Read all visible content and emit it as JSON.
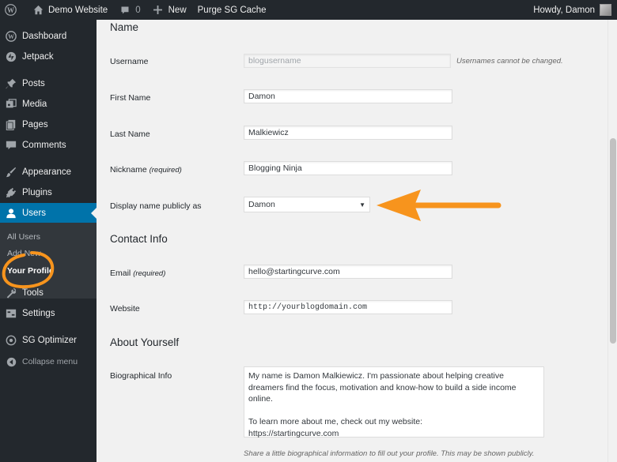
{
  "adminbar": {
    "site_name": "Demo Website",
    "comments_count": "0",
    "new_label": "New",
    "purge_label": "Purge SG Cache",
    "greeting": "Howdy, Damon"
  },
  "sidebar": {
    "items": [
      {
        "label": "Dashboard",
        "icon": "dashboard-icon"
      },
      {
        "label": "Jetpack",
        "icon": "jetpack-icon"
      },
      {
        "label": "Posts",
        "icon": "pin-icon"
      },
      {
        "label": "Media",
        "icon": "media-icon"
      },
      {
        "label": "Pages",
        "icon": "pages-icon"
      },
      {
        "label": "Comments",
        "icon": "comment-icon"
      },
      {
        "label": "Appearance",
        "icon": "brush-icon"
      },
      {
        "label": "Plugins",
        "icon": "plug-icon"
      },
      {
        "label": "Users",
        "icon": "user-icon"
      },
      {
        "label": "Tools",
        "icon": "wrench-icon"
      },
      {
        "label": "Settings",
        "icon": "settings-icon"
      },
      {
        "label": "SG Optimizer",
        "icon": "sg-icon"
      }
    ],
    "submenu": [
      "All Users",
      "Add New",
      "Your Profile"
    ],
    "collapse_label": "Collapse menu"
  },
  "form": {
    "name_heading": "Name",
    "username": {
      "label": "Username",
      "value": "blogusername",
      "note": "Usernames cannot be changed."
    },
    "first_name": {
      "label": "First Name",
      "value": "Damon"
    },
    "last_name": {
      "label": "Last Name",
      "value": "Malkiewicz"
    },
    "nickname": {
      "label": "Nickname",
      "required": "(required)",
      "value": "Blogging Ninja"
    },
    "display_name": {
      "label": "Display name publicly as",
      "value": "Damon"
    },
    "contact_heading": "Contact Info",
    "email": {
      "label": "Email",
      "required": "(required)",
      "value": "hello@startingcurve.com"
    },
    "website": {
      "label": "Website",
      "value": "http://yourblogdomain.com"
    },
    "about_heading": "About Yourself",
    "bio": {
      "label": "Biographical Info",
      "line1": "My name is Damon Malkiewicz. I'm passionate about helping creative",
      "line2": "dreamers find the focus, motivation and know-how to build a side income",
      "line3": "online.",
      "line4": "To learn more about me, check out my website:",
      "line5": "https://startingcurve.com",
      "note": "Share a little biographical information to fill out your profile. This may be shown publicly."
    }
  },
  "annotation_color": "#f7941d",
  "accent_color": "#0073aa"
}
